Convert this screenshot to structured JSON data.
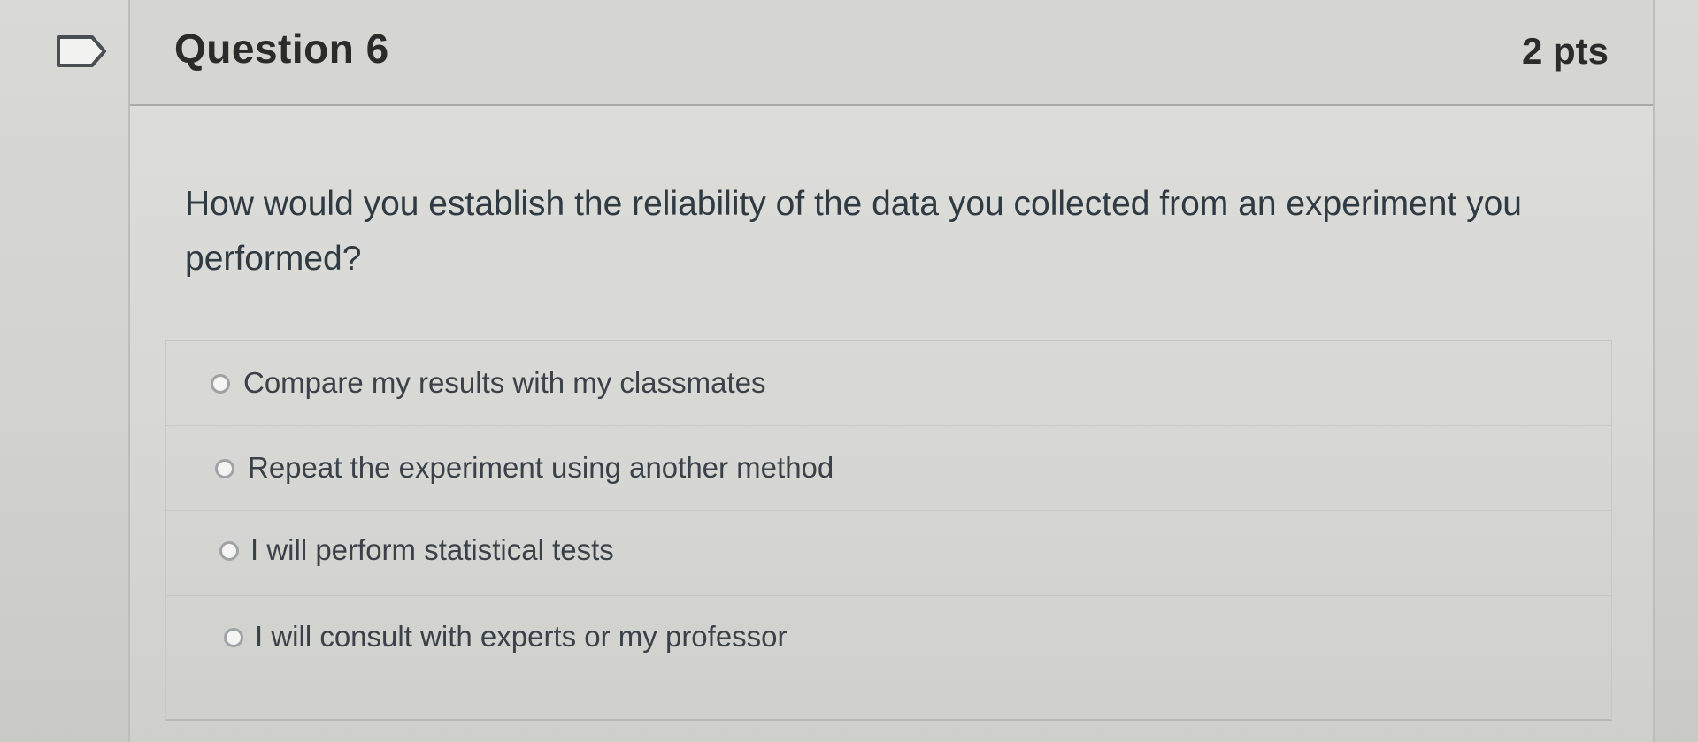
{
  "flag": {
    "icon": "flag-outline-icon"
  },
  "question": {
    "title": "Question 6",
    "points": "2 pts",
    "text": "How would you establish the reliability of the data you collected from an experiment you performed?"
  },
  "answers": [
    {
      "label": "Compare my results with my classmates",
      "selected": false
    },
    {
      "label": "Repeat the experiment using another method",
      "selected": false
    },
    {
      "label": "I will perform statistical tests",
      "selected": false
    },
    {
      "label": "I will consult with experts or my professor",
      "selected": false
    }
  ],
  "colors": {
    "page_background": "#d9d9d6",
    "header_text": "#2b2b2b",
    "body_text": "#2f3a42",
    "radio_border": "#9ea3a6"
  }
}
